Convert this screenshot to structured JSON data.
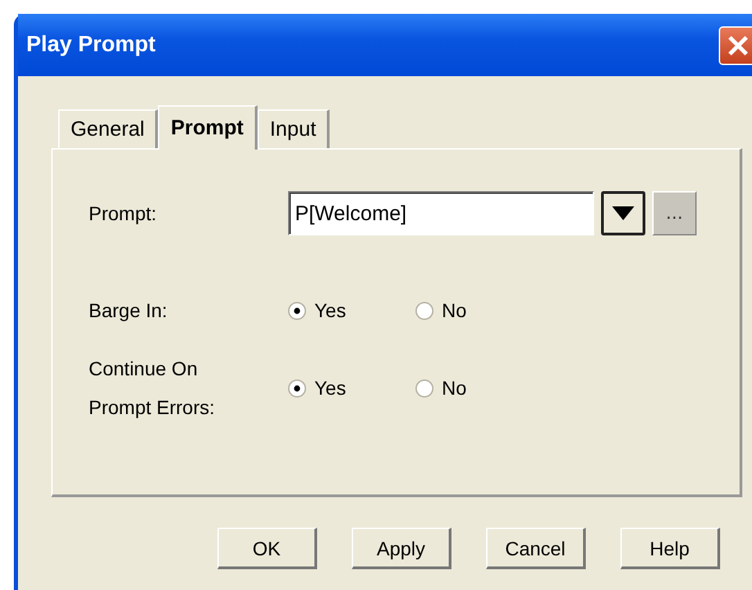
{
  "window": {
    "title": "Play Prompt"
  },
  "tabs": [
    {
      "label": "General",
      "selected": false
    },
    {
      "label": "Prompt",
      "selected": true
    },
    {
      "label": "Input",
      "selected": false
    }
  ],
  "prompt": {
    "label": "Prompt:",
    "value": "P[Welcome]",
    "browse_button": "..."
  },
  "options": [
    {
      "label": "Barge In:",
      "choices": [
        {
          "label": "Yes",
          "selected": true
        },
        {
          "label": "No",
          "selected": false
        }
      ]
    },
    {
      "label": "Continue On\nPrompt Errors:",
      "choices": [
        {
          "label": "Yes",
          "selected": true
        },
        {
          "label": "No",
          "selected": false
        }
      ]
    }
  ],
  "buttons": [
    "OK",
    "Apply",
    "Cancel",
    "Help"
  ]
}
